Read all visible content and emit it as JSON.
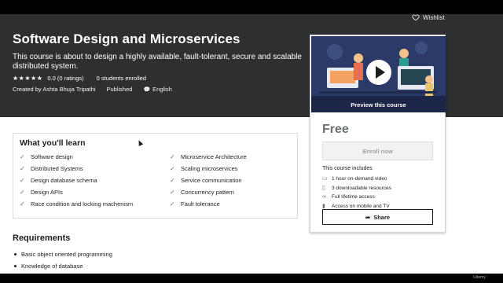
{
  "header": {
    "wishlist_label": "Wishlist",
    "title": "Software Design and Microservices",
    "subtitle": "This course is about to design a highly available, fault-tolerant, secure and scalable distributed system.",
    "rating_stars": "★★★★★",
    "rating_text": "0.0 (0 ratings)",
    "enrolled": "0 students enrolled",
    "created_by": "Created by Ashta Bhuja Tripathi",
    "status": "Published",
    "language": "English"
  },
  "learn": {
    "title": "What you'll learn",
    "left": [
      "Software design",
      "Distributed Systems",
      "Design database schema",
      "Design APIs",
      "Race condition and locking machenism"
    ],
    "right": [
      "Microservice Architecture",
      "Scaling microservices",
      "Service communication",
      "Concurrency pattern",
      "Fault tolerance"
    ]
  },
  "requirements": {
    "title": "Requirements",
    "items": [
      "Basic object oriented programming",
      "Knowledge of database"
    ]
  },
  "card": {
    "preview_label": "Preview this course",
    "price": "Free",
    "enroll_label": "Enroll now",
    "includes_title": "This course includes",
    "includes": [
      {
        "icon": "video-icon",
        "text": "1 hour on-demand video"
      },
      {
        "icon": "file-icon",
        "text": "3 downloadable resources"
      },
      {
        "icon": "infinity-icon",
        "text": "Full lifetime access"
      },
      {
        "icon": "mobile-icon",
        "text": "Access on mobile and TV"
      }
    ],
    "share_label": "Share"
  },
  "watermark": "Udemy",
  "colors": {
    "hero_bg": "#2d2f31",
    "preview_bg": "#2b3a66",
    "text_dark": "#1c1d1f",
    "muted": "#6a6f73"
  }
}
